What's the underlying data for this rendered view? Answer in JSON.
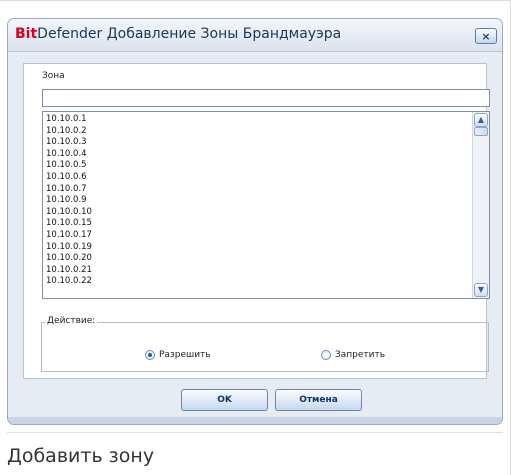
{
  "dialog": {
    "title_brand": "Bit",
    "title_brand_rest": "Defender",
    "title_text": " Добавление Зоны Брандмауэра",
    "close_glyph": "×",
    "zone_label": "Зона",
    "zone_value": "",
    "ip_list": [
      "10.10.0.1",
      "10.10.0.2",
      "10.10.0.3",
      "10.10.0.4",
      "10.10.0.5",
      "10.10.0.6",
      "10.10.0.7",
      "10.10.0.9",
      "10.10.0.10",
      "10.10.0.15",
      "10.10.0.17",
      "10.10.0.19",
      "10.10.0.20",
      "10.10.0.21",
      "10.10.0.22"
    ],
    "action_legend": "Действие:",
    "radio_allow": "Разрешить",
    "radio_deny": "Запретить",
    "allow_selected": true,
    "ok_label": "OK",
    "cancel_label": "Отмена",
    "scroll_up_icon": "chevron-up-icon",
    "scroll_down_icon": "chevron-down-icon",
    "brand_color": "#d8001b",
    "title_color": "#1d3556"
  },
  "caption": "Добавить зону"
}
